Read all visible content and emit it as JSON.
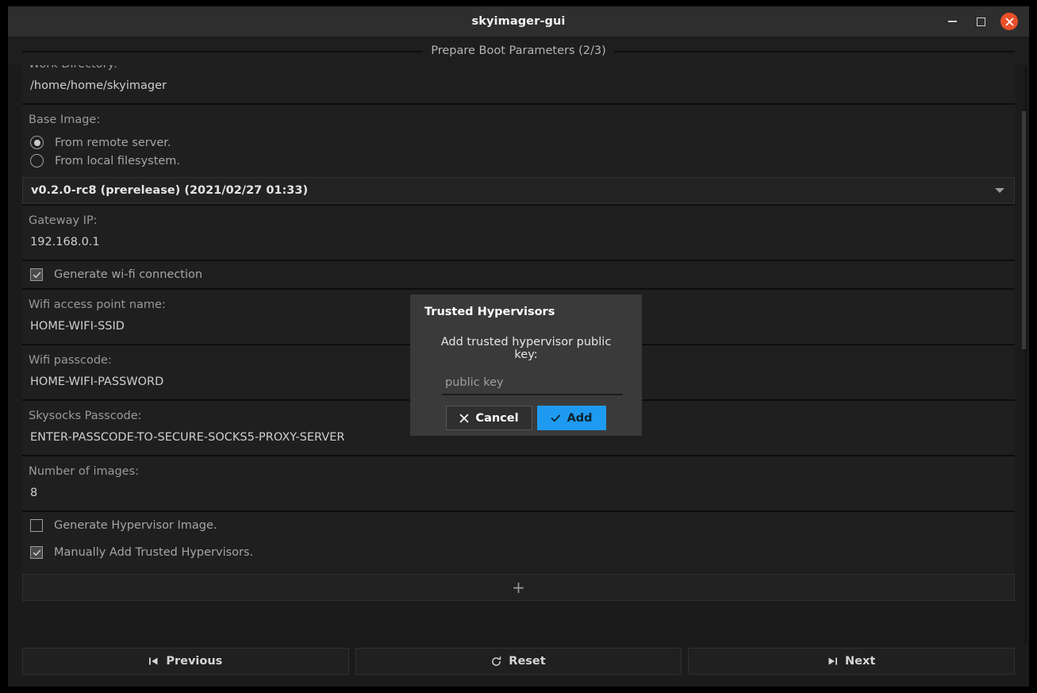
{
  "window": {
    "title": "skyimager-gui",
    "controls": {
      "minimize": "minimize",
      "maximize": "maximize",
      "close": "close"
    }
  },
  "step_header": {
    "title": "Prepare Boot Parameters (2/3)"
  },
  "form": {
    "work_directory": {
      "label": "Work Directory:",
      "value": "/home/home/skyimager"
    },
    "base_image": {
      "label": "Base Image:",
      "radios": [
        {
          "label": "From remote server.",
          "selected": true
        },
        {
          "label": "From local filesystem.",
          "selected": false
        }
      ],
      "selected_version": "v0.2.0-rc8 (prerelease) (2021/02/27 01:33)"
    },
    "gateway_ip": {
      "label": "Gateway IP:",
      "value": "192.168.0.1"
    },
    "generate_wifi": {
      "label": "Generate wi-fi connection",
      "checked": true
    },
    "wifi_ssid": {
      "label": "Wifi access point name:",
      "value": "HOME-WIFI-SSID"
    },
    "wifi_passcode": {
      "label": "Wifi passcode:",
      "value": "HOME-WIFI-PASSWORD"
    },
    "skysocks_passcode": {
      "label": "Skysocks Passcode:",
      "value": "ENTER-PASSCODE-TO-SECURE-SOCKS5-PROXY-SERVER"
    },
    "number_of_images": {
      "label": "Number of images:",
      "value": "8"
    },
    "generate_hypervisor_image": {
      "label": "Generate Hypervisor Image.",
      "checked": false
    },
    "manually_add_hypervisors": {
      "label": "Manually Add Trusted Hypervisors.",
      "checked": true
    },
    "add_hypervisor_button": {
      "label": "+"
    }
  },
  "bottom_nav": {
    "previous": "Previous",
    "reset": "Reset",
    "next": "Next"
  },
  "modal": {
    "title": "Trusted Hypervisors",
    "prompt": "Add trusted hypervisor public key:",
    "input_placeholder": "public key",
    "input_value": "",
    "cancel_label": "Cancel",
    "add_label": "Add"
  },
  "colors": {
    "accent_blue": "#1e9bf0",
    "close_orange": "#e8502a",
    "window_bg": "#1c1c1c",
    "modal_bg": "#3a3a3a"
  }
}
